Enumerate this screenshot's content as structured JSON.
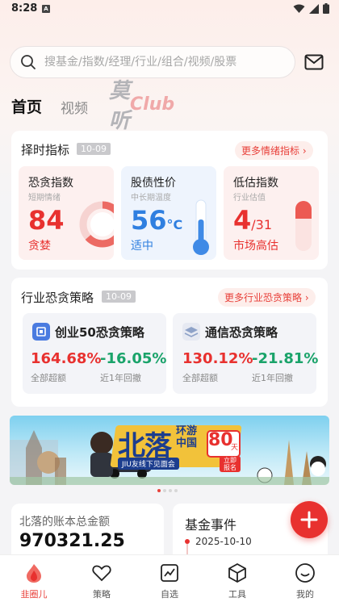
{
  "status_bar": {
    "time": "8:28",
    "notif_badge": "A"
  },
  "search": {
    "placeholder": "搜基金/指数/经理/行业/组合/视频/股票"
  },
  "tabs": {
    "home": "首页",
    "video": "视频",
    "club_cn": "莫听",
    "club_en": "Club"
  },
  "timing": {
    "title": "择时指标",
    "date": "10-09",
    "more": "更多情绪指标",
    "metrics": [
      {
        "title": "恐贪指数",
        "subtitle": "短期情绪",
        "value": "84",
        "unit": "",
        "label": "贪婪",
        "gauge_level": 0.84
      },
      {
        "title": "股债性价",
        "subtitle": "中长期温度",
        "value": "56",
        "unit": "°C",
        "label": "适中",
        "thermo_level": 0.56
      },
      {
        "title": "低估指数",
        "subtitle": "行业估值",
        "value": "4",
        "unit": "/31",
        "label": "市场高估",
        "bar_level": 0.13
      }
    ]
  },
  "industry": {
    "title": "行业恐贪策略",
    "date": "10-09",
    "more": "更多行业恐贪策略",
    "strategies": [
      {
        "title": "创业50恐贪策略",
        "return": "164.68%",
        "return_label": "全部超额",
        "drawdown": "-16.05%",
        "drawdown_label": "近1年回撤"
      },
      {
        "title": "通信恐贪策略",
        "return": "130.12%",
        "return_label": "全部超额",
        "drawdown": "-21.81%",
        "drawdown_label": "近1年回撤"
      }
    ]
  },
  "banner": {
    "big_title": "北落",
    "side_title": "环游中国",
    "days": "80",
    "days_unit": "天",
    "subtitle": "JIU友线下见面会",
    "cta": "立即报名"
  },
  "account": {
    "title": "北落的账本总金额",
    "amount": "970321.25"
  },
  "fund_events": {
    "title": "基金事件",
    "date": "2025-10-10"
  },
  "bottom_nav": [
    {
      "label": "韭圈儿",
      "icon": "home-fire-icon"
    },
    {
      "label": "策略",
      "icon": "heart-icon"
    },
    {
      "label": "自选",
      "icon": "chart-icon"
    },
    {
      "label": "工具",
      "icon": "cube-icon"
    },
    {
      "label": "我的",
      "icon": "smile-icon"
    }
  ],
  "colors": {
    "red": "#e8312f",
    "green": "#1aa36a",
    "blue": "#2f7fe0"
  }
}
